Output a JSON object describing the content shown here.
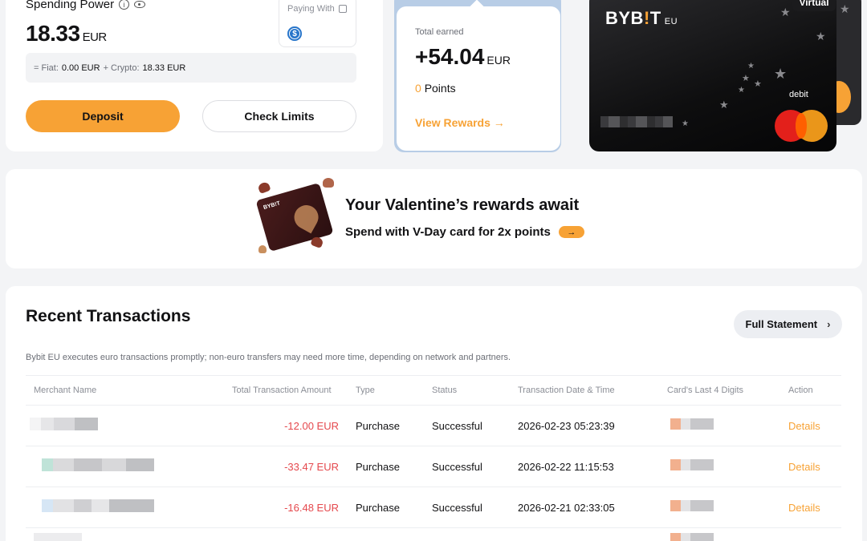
{
  "spending": {
    "label": "Spending Power",
    "amount": "18.33",
    "currency": "EUR",
    "paying_with_label": "Paying With",
    "paying_with_icon": "usdc-coin-icon",
    "fiat_label": "= Fiat:",
    "fiat_value": "0.00 EUR",
    "crypto_label": "+ Crypto:",
    "crypto_value": "18.33 EUR",
    "deposit_label": "Deposit",
    "limits_label": "Check Limits"
  },
  "rewards": {
    "label": "Total earned",
    "amount": "+54.04",
    "currency": "EUR",
    "points_count": "0",
    "points_label": "Points",
    "link_label": "View Rewards →"
  },
  "card": {
    "brand": "BYB",
    "brand_bang": "!",
    "brand_tail": "T",
    "region": "EU",
    "debit_label": "debit",
    "virtual_label": "Virtual"
  },
  "promo": {
    "title": "Your Valentine’s rewards await",
    "subtitle": "Spend with V-Day card for 2x points",
    "arrow": "→",
    "card_brand": "BYB!T"
  },
  "transactions": {
    "title": "Recent Transactions",
    "statement_label": "Full Statement",
    "note": "Bybit EU executes euro transactions promptly; non-euro transfers may need more time, depending on network and partners.",
    "columns": [
      "Merchant Name",
      "Total Transaction Amount",
      "Type",
      "Status",
      "Transaction Date & Time",
      "Card's Last 4 Digits",
      "Action"
    ],
    "rows": [
      {
        "amount": "-12.00 EUR",
        "type": "Purchase",
        "status": "Successful",
        "datetime": "2026-02-23 05:23:39",
        "action": "Details"
      },
      {
        "amount": "-33.47 EUR",
        "type": "Purchase",
        "status": "Successful",
        "datetime": "2026-02-22 11:15:53",
        "action": "Details"
      },
      {
        "amount": "-16.48 EUR",
        "type": "Purchase",
        "status": "Successful",
        "datetime": "2026-02-21 02:33:05",
        "action": "Details"
      }
    ]
  },
  "colors": {
    "accent": "#f7a235",
    "negative": "#e5484d",
    "background": "#f3f4f6"
  }
}
